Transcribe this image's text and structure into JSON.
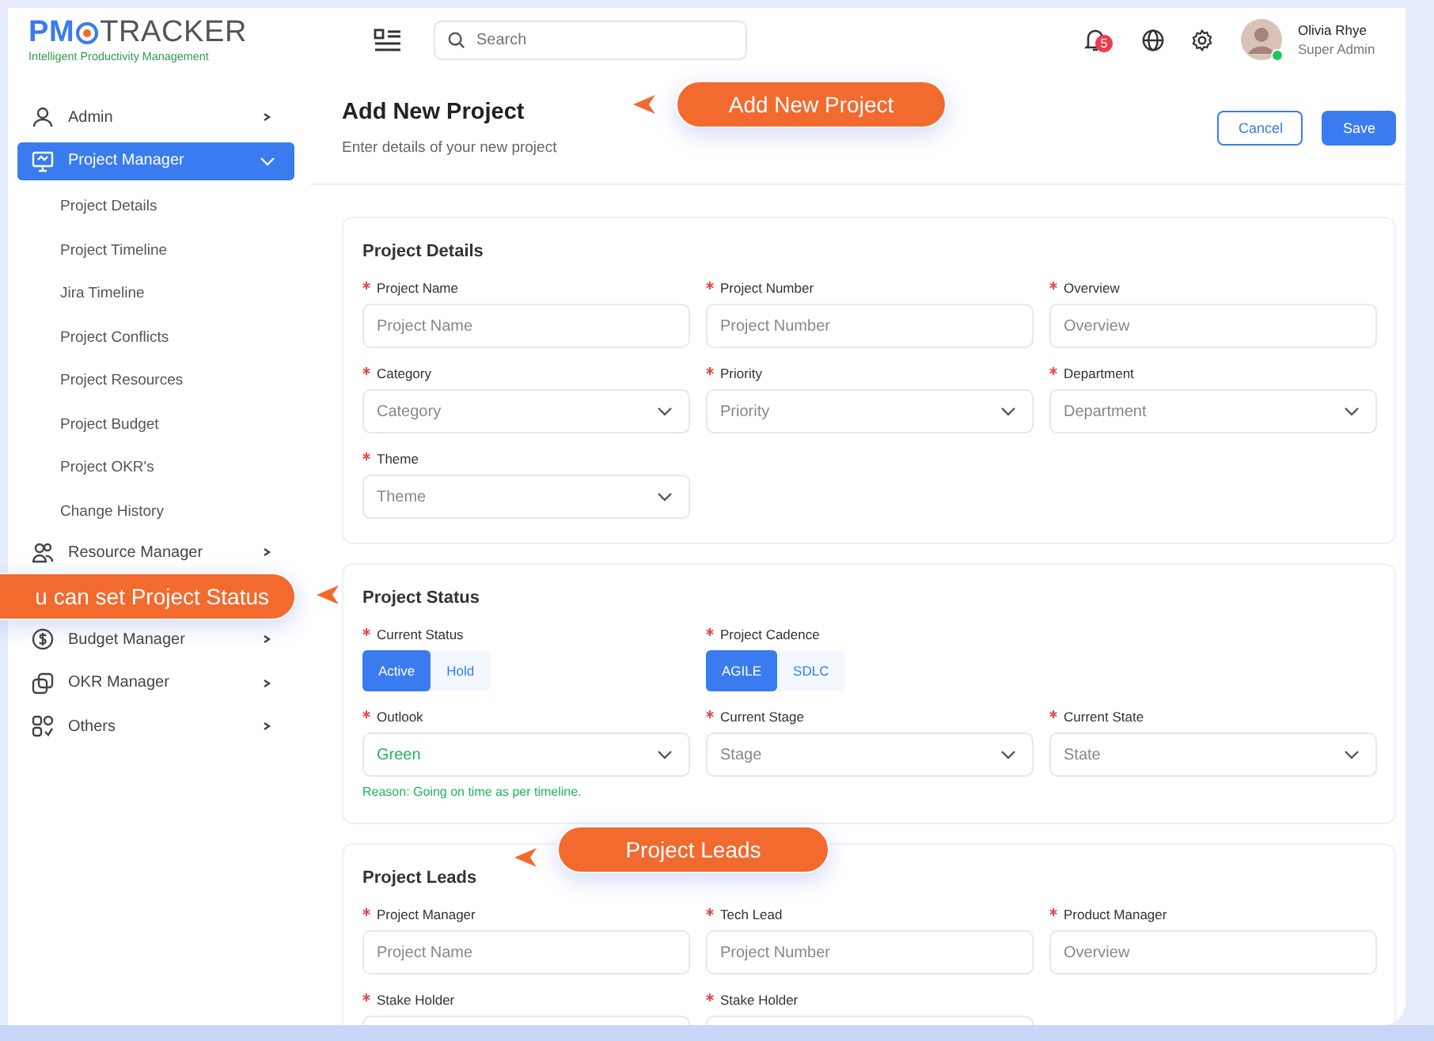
{
  "header": {
    "logo": {
      "left": "PM",
      "right": "TRACKER",
      "tagline": "Intelligent Productivity Management"
    },
    "search": {
      "placeholder": "Search"
    },
    "notifications": {
      "count": "5"
    },
    "user": {
      "name": "Olivia Rhye",
      "role": "Super Admin",
      "online": true
    }
  },
  "sidebar": {
    "items": [
      {
        "label": "Admin",
        "selected": false,
        "expanded": false
      },
      {
        "label": "Project Manager",
        "selected": true,
        "expanded": true,
        "children": [
          {
            "label": "Project Details"
          },
          {
            "label": "Project Timeline"
          },
          {
            "label": "Jira Timeline"
          },
          {
            "label": "Project Conflicts"
          },
          {
            "label": "Project Resources"
          },
          {
            "label": "Project Budget"
          },
          {
            "label": "Project OKR's"
          },
          {
            "label": "Change History"
          }
        ]
      },
      {
        "label": "Resource Manager",
        "selected": false,
        "expanded": false
      },
      {
        "label": "Budget Manager",
        "selected": false,
        "expanded": false
      },
      {
        "label": "OKR Manager",
        "selected": false,
        "expanded": false
      },
      {
        "label": "Others",
        "selected": false,
        "expanded": false
      }
    ]
  },
  "page": {
    "title": "Add New Project",
    "subtitle": "Enter details of your new project",
    "buttons": [
      {
        "label": "Cancel",
        "kind": "secondary"
      },
      {
        "label": "Save",
        "kind": "primary"
      }
    ]
  },
  "sections": [
    {
      "title": "Project Details",
      "fields": [
        {
          "kind": "input",
          "label": "Project Name",
          "required": true,
          "placeholder": "Project Name"
        },
        {
          "kind": "input",
          "label": "Project Number",
          "required": true,
          "placeholder": "Project Number"
        },
        {
          "kind": "input",
          "label": "Overview",
          "required": true,
          "placeholder": "Overview"
        },
        {
          "kind": "select",
          "label": "Category",
          "required": true,
          "placeholder": "Category"
        },
        {
          "kind": "select",
          "label": "Priority",
          "required": true,
          "placeholder": "Priority"
        },
        {
          "kind": "select",
          "label": "Department",
          "required": true,
          "placeholder": "Department"
        },
        {
          "kind": "select",
          "label": "Theme",
          "required": true,
          "placeholder": "Theme"
        }
      ]
    },
    {
      "title": "Project Status",
      "fields": [
        {
          "kind": "segmented",
          "label": "Current Status",
          "required": true,
          "options": [
            {
              "label": "Active",
              "selected": true
            },
            {
              "label": "Hold",
              "selected": false
            }
          ]
        },
        {
          "kind": "segmented",
          "label": "Project Cadence",
          "required": true,
          "options": [
            {
              "label": "AGILE",
              "selected": true
            },
            {
              "label": "SDLC",
              "selected": false
            }
          ]
        },
        {
          "kind": "spacer"
        },
        {
          "kind": "select",
          "label": "Outlook",
          "required": true,
          "value": "Green",
          "color": "#22b35e",
          "note": "Reason: Going on time as per timeline."
        },
        {
          "kind": "select",
          "label": "Current Stage",
          "required": true,
          "placeholder": "Stage"
        },
        {
          "kind": "select",
          "label": "Current State",
          "required": true,
          "placeholder": "State"
        }
      ]
    },
    {
      "title": "Project Leads",
      "fields": [
        {
          "kind": "input",
          "label": "Project Manager",
          "required": true,
          "placeholder": "Project Name"
        },
        {
          "kind": "input",
          "label": "Tech Lead",
          "required": true,
          "placeholder": "Project Number"
        },
        {
          "kind": "input",
          "label": "Product Manager",
          "required": true,
          "placeholder": "Overview"
        },
        {
          "kind": "input",
          "label": "Stake Holder",
          "required": true
        },
        {
          "kind": "input",
          "label": "Stake Holder",
          "required": true
        }
      ]
    }
  ],
  "callouts": [
    {
      "text": "Add New Project"
    },
    {
      "text": "u can set Project Status"
    },
    {
      "text": "Project Leads"
    }
  ]
}
